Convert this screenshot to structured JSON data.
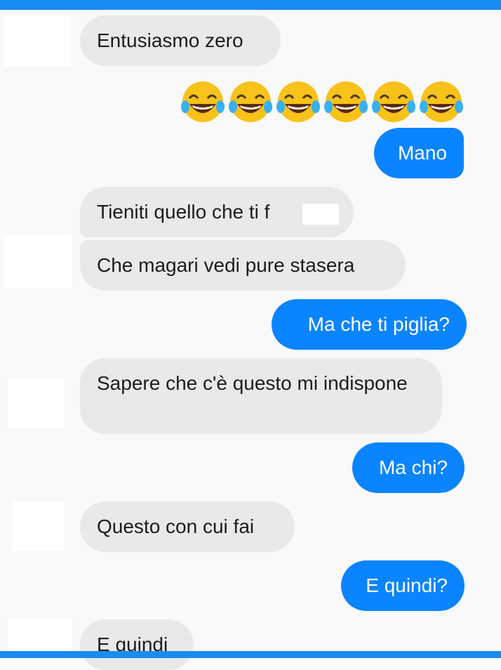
{
  "messages": [
    {
      "side": "in",
      "text": "Entusiasmo zero"
    },
    {
      "side": "out",
      "emoji": "face-with-tears-of-joy",
      "count": 6
    },
    {
      "side": "out",
      "text": "Mano"
    },
    {
      "side": "in",
      "text": "Tieniti quello che ti f"
    },
    {
      "side": "in",
      "text": "Che magari vedi pure stasera"
    },
    {
      "side": "out",
      "text": "Ma che ti piglia?"
    },
    {
      "side": "in",
      "text": "Sapere che c'è questo mi indispone"
    },
    {
      "side": "out",
      "text": "Ma chi?"
    },
    {
      "side": "in",
      "text": "Questo con cui fai"
    },
    {
      "side": "out",
      "text": "E quindi?"
    },
    {
      "side": "in",
      "text": "E quindi"
    }
  ],
  "colors": {
    "accent": "#1a8cf0",
    "outgoing_bubble": "#0b84ff",
    "incoming_bubble": "#e9e9e9",
    "background": "#f9f9f9"
  }
}
